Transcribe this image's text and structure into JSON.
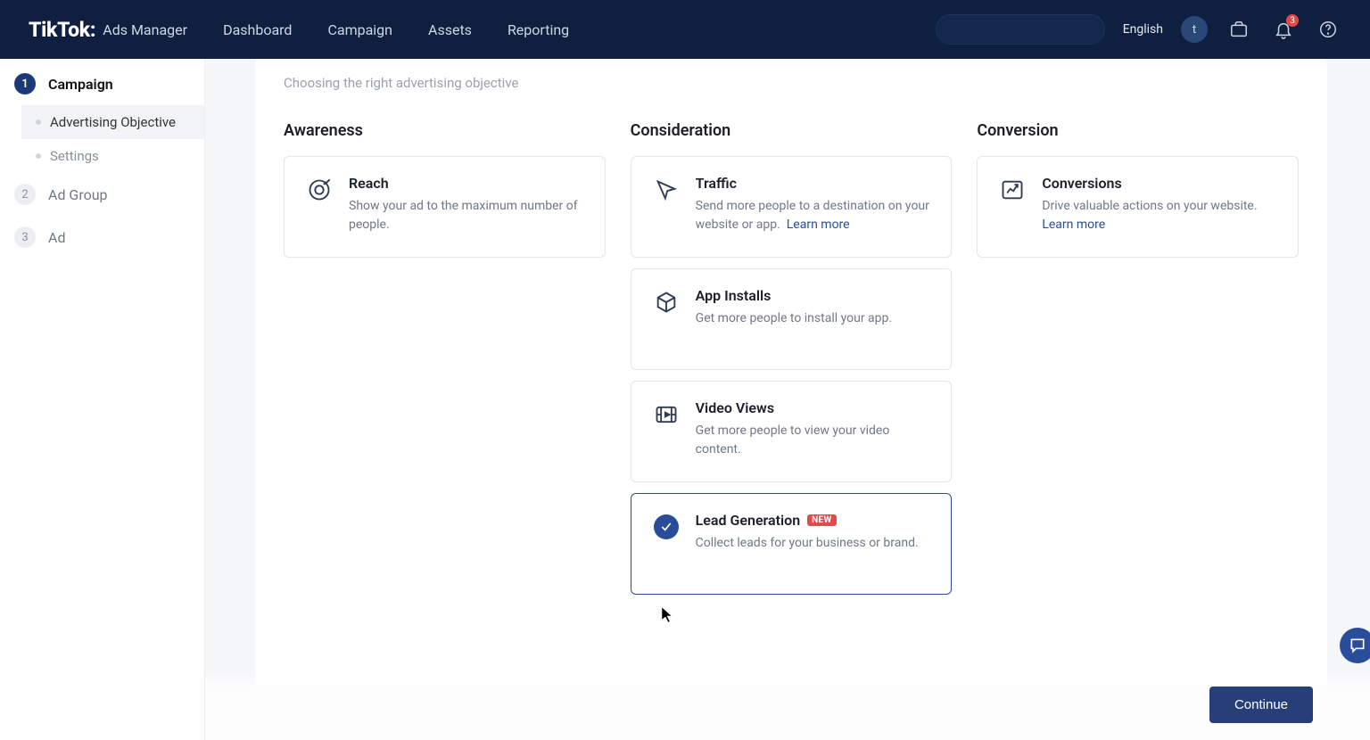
{
  "header": {
    "brand_main": "TikTok:",
    "brand_sub": "Ads Manager",
    "nav": [
      "Dashboard",
      "Campaign",
      "Assets",
      "Reporting"
    ],
    "language": "English",
    "avatar_letter": "t",
    "notif_count": "3"
  },
  "sidebar": {
    "steps": [
      {
        "num": "1",
        "label": "Campaign",
        "active": true,
        "subs": [
          {
            "label": "Advertising Objective",
            "active": true
          },
          {
            "label": "Settings",
            "active": false
          }
        ]
      },
      {
        "num": "2",
        "label": "Ad Group",
        "active": false
      },
      {
        "num": "3",
        "label": "Ad",
        "active": false
      }
    ]
  },
  "page": {
    "subtitle": "Choosing the right advertising objective",
    "columns": [
      {
        "heading": "Awareness",
        "cards": [
          {
            "icon": "target",
            "title": "Reach",
            "desc": "Show your ad to the maximum number of people."
          }
        ]
      },
      {
        "heading": "Consideration",
        "cards": [
          {
            "icon": "cursor",
            "title": "Traffic",
            "desc": "Send more people to a destination on your website or app.",
            "learn_more": "Learn more"
          },
          {
            "icon": "box",
            "title": "App Installs",
            "desc": "Get more people to install your app."
          },
          {
            "icon": "video",
            "title": "Video Views",
            "desc": "Get more people to view your video content."
          },
          {
            "icon": "check",
            "title": "Lead Generation",
            "desc": "Collect leads for your business or brand.",
            "new": "NEW",
            "selected": true
          }
        ]
      },
      {
        "heading": "Conversion",
        "cards": [
          {
            "icon": "chart",
            "title": "Conversions",
            "desc": "Drive valuable actions on your website.",
            "learn_more": "Learn more"
          }
        ]
      }
    ],
    "continue_label": "Continue"
  }
}
